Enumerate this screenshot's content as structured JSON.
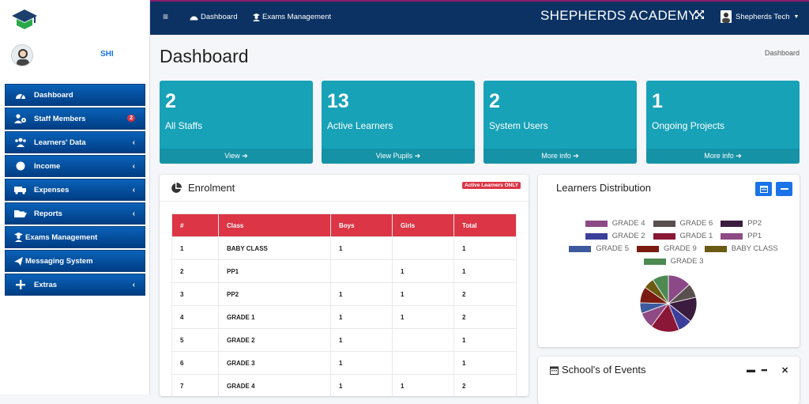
{
  "sidebar": {
    "user_name": "SHI",
    "items": [
      {
        "label": "Dashboard",
        "icon": "tachometer-icon"
      },
      {
        "label": "Staff Members",
        "icon": "users-cog-icon",
        "badge": "2"
      },
      {
        "label": "Learners' Data",
        "icon": "users-icon",
        "chevron": "‹"
      },
      {
        "label": "Income",
        "icon": "coins-icon",
        "chevron": "‹"
      },
      {
        "label": "Expenses",
        "icon": "truck-icon",
        "chevron": "‹"
      },
      {
        "label": "Reports",
        "icon": "folder-open-icon",
        "chevron": "‹"
      },
      {
        "label": "Exams Management",
        "icon": "user-graduate-icon"
      },
      {
        "label": "Messaging System",
        "icon": "paper-plane-icon"
      },
      {
        "label": "Extras",
        "icon": "plus-icon",
        "chevron": "‹"
      }
    ]
  },
  "topbar": {
    "menu": "≡",
    "links": [
      "Dashboard",
      "Exams Management"
    ],
    "brand": "SHEPHERDS ACADEMY",
    "account": "Shepherds Tech"
  },
  "page": {
    "title": "Dashboard",
    "breadcrumb": "Dashboard"
  },
  "stats": [
    {
      "value": "2",
      "label": "All Staffs",
      "link": "View"
    },
    {
      "value": "13",
      "label": "Active Learners",
      "link": "View Pupils"
    },
    {
      "value": "2",
      "label": "System Users",
      "link": "More info"
    },
    {
      "value": "1",
      "label": "Ongoing Projects",
      "link": "More info"
    }
  ],
  "enrolment": {
    "title": "Enrolment",
    "pill": "Active Learners ONLY",
    "headers": [
      "#",
      "Class",
      "Boys",
      "Girls",
      "Total"
    ],
    "rows": [
      [
        "1",
        "BABY CLASS",
        "1",
        "",
        "1"
      ],
      [
        "2",
        "PP1",
        "",
        "1",
        "1"
      ],
      [
        "3",
        "PP2",
        "1",
        "1",
        "2"
      ],
      [
        "4",
        "GRADE 1",
        "1",
        "1",
        "2"
      ],
      [
        "5",
        "GRADE 2",
        "1",
        "",
        "1"
      ],
      [
        "6",
        "GRADE 3",
        "1",
        "",
        "1"
      ],
      [
        "7",
        "GRADE 4",
        "1",
        "1",
        "2"
      ]
    ]
  },
  "distribution": {
    "title": "Learners Distribution",
    "legend": [
      [
        "GRADE 4",
        "GRADE 6",
        "PP2"
      ],
      [
        "GRADE 2",
        "GRADE 1",
        "PP1"
      ],
      [
        "GRADE 5",
        "GRADE 9",
        "BABY CLASS"
      ],
      [
        "GRADE 3"
      ]
    ],
    "colors": {
      "GRADE 4": "#8b4a87",
      "GRADE 6": "#5a4f4f",
      "PP2": "#3b1c3f",
      "GRADE 2": "#3c3f9a",
      "GRADE 1": "#8b1736",
      "PP1": "#8f4a86",
      "GRADE 5": "#3e5a9e",
      "GRADE 9": "#7a1a10",
      "BABY CLASS": "#6b5a12",
      "GRADE 3": "#4d8a52"
    }
  },
  "events": {
    "title": "School's of Events"
  }
}
